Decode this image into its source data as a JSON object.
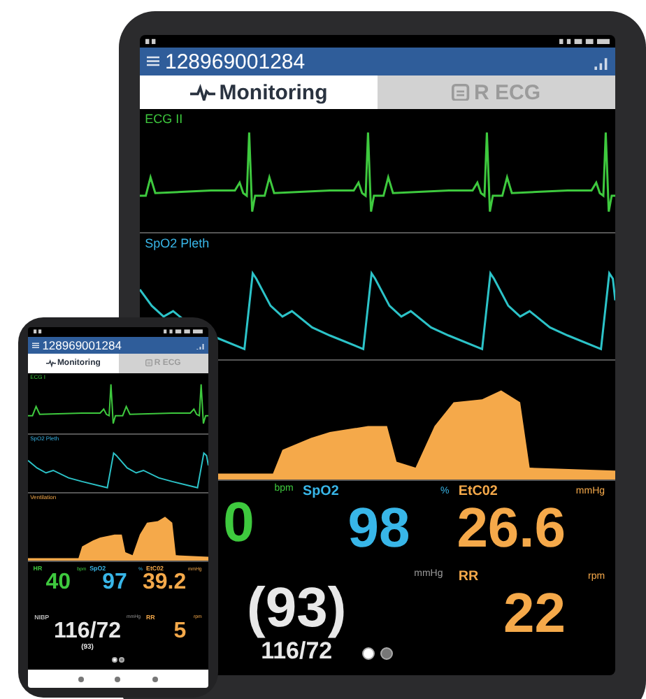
{
  "tablet": {
    "device_id": "128969001284",
    "tabs": [
      {
        "label": "Monitoring",
        "kind": "monitor",
        "selected": true
      },
      {
        "label": "R ECG",
        "kind": "ecg",
        "selected": false
      }
    ],
    "waveforms": [
      {
        "label": "ECG II",
        "kind": "ecg"
      },
      {
        "label": "SpO2 Pleth",
        "kind": "pleth"
      },
      {
        "kind": "ventilation"
      }
    ],
    "vitals": [
      {
        "kind": "numeric",
        "unit": "bpm",
        "value": "0",
        "color": "#3ec93e"
      },
      {
        "kind": "numeric",
        "label": "SpO2",
        "unit": "%",
        "value": "98",
        "color": "#38b6e8"
      },
      {
        "kind": "numeric",
        "label": "EtC02",
        "unit": "mmHg",
        "value": "26.6",
        "color": "#f5a94a"
      },
      {
        "kind": "pressure",
        "unit": "mmHg",
        "value": "(93)",
        "sub": "116/72",
        "color": "#e8e8e8"
      },
      {
        "kind": "numeric",
        "label": "RR",
        "unit": "rpm",
        "value": "22",
        "color": "#f5a94a"
      }
    ],
    "pages": [
      {
        "selected": true
      },
      {
        "selected": false
      }
    ]
  },
  "phone": {
    "device_id": "128969001284",
    "tabs": [
      {
        "label": "Monitoring",
        "kind": "monitor",
        "selected": true
      },
      {
        "label": "R ECG",
        "kind": "ecg",
        "selected": false
      }
    ],
    "waveforms": [
      {
        "label": "ECG I",
        "kind": "ecg"
      },
      {
        "label": "SpO2 Pleth",
        "kind": "pleth"
      },
      {
        "label": "Ventilation",
        "kind": "ventilation"
      }
    ],
    "vitals": [
      {
        "kind": "numeric",
        "label": "HR",
        "unit": "bpm",
        "value": "40",
        "color": "#3ec93e"
      },
      {
        "kind": "numeric",
        "label": "SpO2",
        "unit": "%",
        "value": "97",
        "color": "#38b6e8"
      },
      {
        "kind": "numeric",
        "label": "EtC02",
        "unit": "mmHg",
        "value": "39.2",
        "color": "#f5a94a"
      },
      {
        "kind": "pressure",
        "label": "NIBP",
        "unit": "mmHg",
        "value": "116/72",
        "sub": "(93)",
        "color": "#e8e8e8"
      },
      {
        "kind": "numeric",
        "label": "RR",
        "unit": "rpm",
        "value": "5",
        "color": "#f5a94a"
      }
    ],
    "pages": [
      {
        "selected": true
      },
      {
        "selected": false
      }
    ]
  }
}
